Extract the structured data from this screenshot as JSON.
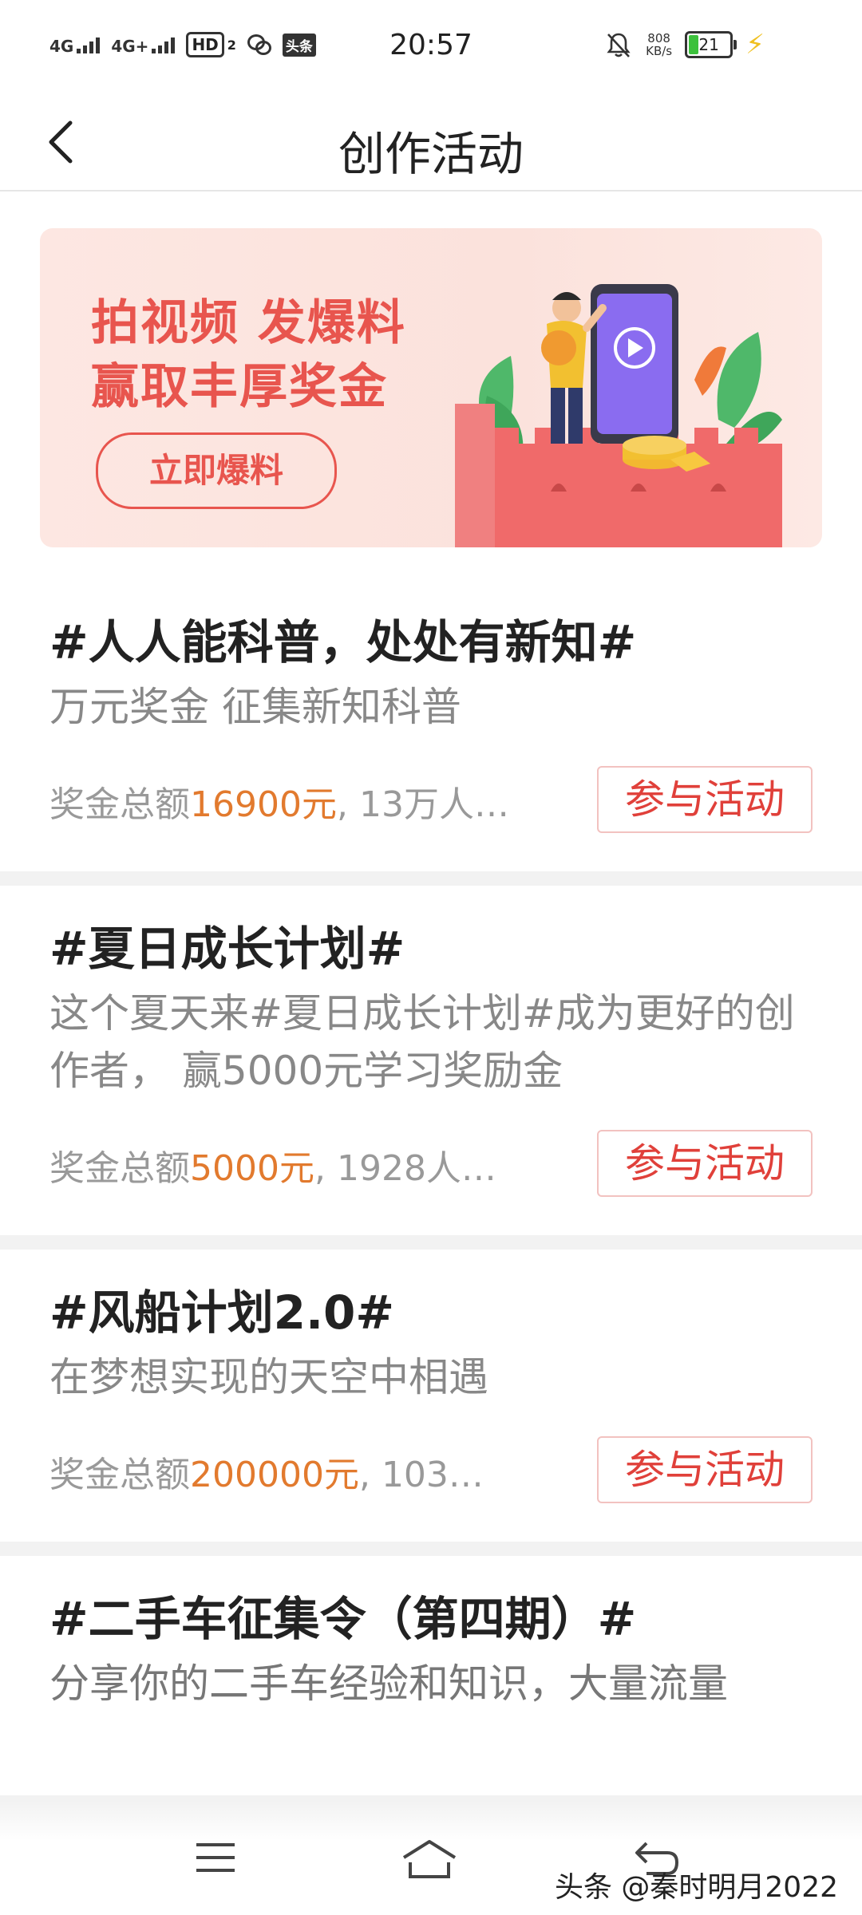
{
  "status_bar": {
    "signal1": "4G",
    "signal2": "4G+",
    "hd_label": "HD",
    "hd_sub": "2",
    "app_mini": "头条",
    "time": "20:57",
    "net_speed": "808",
    "net_unit": "KB/s",
    "battery": "21"
  },
  "header": {
    "title": "创作活动"
  },
  "banner": {
    "line1": "拍视频 发爆料",
    "line2": "赢取丰厚奖金",
    "button": "立即爆料"
  },
  "activities": [
    {
      "title": "#人人能科普，处处有新知#",
      "desc": "万元奖金 征集新知科普",
      "meta_prefix": "奖金总额",
      "amount": "16900元",
      "meta_suffix": ", 13万人…",
      "button": "参与活动"
    },
    {
      "title": "#夏日成长计划#",
      "desc": "这个夏天来#夏日成长计划#成为更好的创作者， 赢5000元学习奖励金",
      "meta_prefix": "奖金总额",
      "amount": "5000元",
      "meta_suffix": ", 1928人…",
      "button": "参与活动"
    },
    {
      "title": "#风船计划2.0#",
      "desc": "在梦想实现的天空中相遇",
      "meta_prefix": "奖金总额",
      "amount": "200000元",
      "meta_suffix": ", 103…",
      "button": "参与活动"
    },
    {
      "title": "#二手车征集令（第四期）#",
      "desc": "分享你的二手车经验和知识，大量流量"
    }
  ],
  "watermark": "头条 @秦时明月2022",
  "colors": {
    "accent_red": "#e0403a",
    "amount_orange": "#e27a2e",
    "banner_text": "#e8554e"
  }
}
